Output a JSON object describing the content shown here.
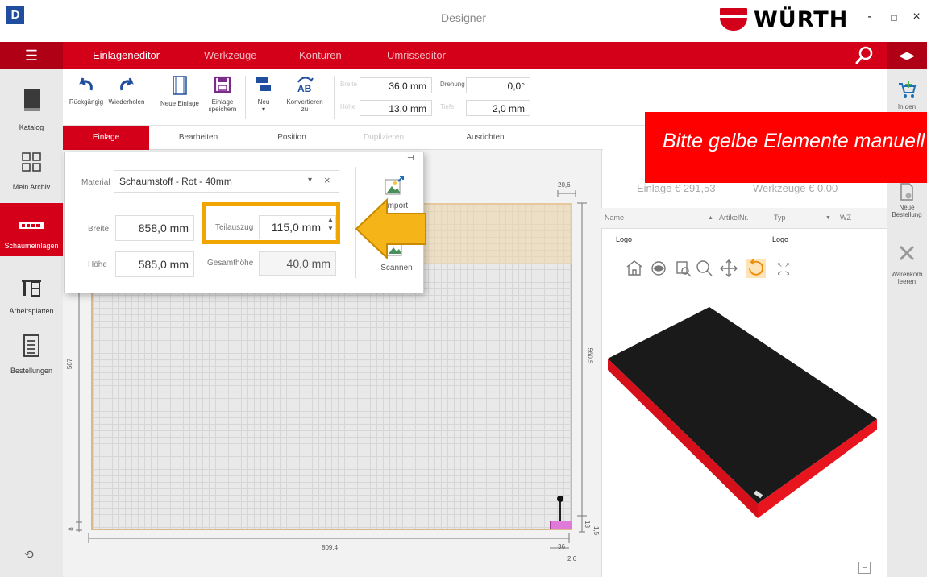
{
  "window": {
    "logo_letter": "D",
    "title": "Designer",
    "brand": "WÜRTH",
    "minimize": "-",
    "maximize": "□",
    "close": "×"
  },
  "menu": {
    "tabs": [
      "Einlageneditor",
      "Werkzeuge",
      "Konturen",
      "Umrisseditor"
    ]
  },
  "sidebar": {
    "items": [
      {
        "label": "Katalog"
      },
      {
        "label": "Mein Archiv"
      },
      {
        "label": "Schaumeinlagen"
      },
      {
        "label": "Arbeitsplatten"
      },
      {
        "label": "Bestellungen"
      }
    ]
  },
  "rightbar": {
    "cart_label": "In den",
    "new_order_label_1": "Neue",
    "new_order_label_2": "Bestellung",
    "clear_cart_label_1": "Warenkorb",
    "clear_cart_label_2": "leeren"
  },
  "ribbon": {
    "undo": "Rückgängig",
    "redo": "Wiederholen",
    "new_insert": "Neue Einlage",
    "save_1": "Einlage",
    "save_2": "speichern",
    "new_1": "Neu",
    "convert_1": "Konvertieren",
    "convert_2": "zu",
    "breite_label": "Breite",
    "breite_value": "36,0 mm",
    "hoehe_label": "Höhe",
    "hoehe_value": "13,0 mm",
    "drehung_label": "Drehung",
    "drehung_value": "0,0°",
    "tiefe_label": "Tiefe",
    "tiefe_value": "2,0 mm"
  },
  "subtabs": [
    "Einlage",
    "Bearbeiten",
    "Position",
    "Duplizieren",
    "Ausrichten"
  ],
  "panel": {
    "material_label": "Material",
    "material_value": "Schaumstoff - Rot - 40mm",
    "breite_label": "Breite",
    "breite_value": "858,0 mm",
    "hoehe_label": "Höhe",
    "hoehe_value": "585,0 mm",
    "teilauszug_label": "Teilauszug",
    "teilauszug_value": "115,0 mm",
    "gesamthoehe_label": "Gesamthöhe",
    "gesamthoehe_value": "40,0 mm",
    "import_label": "Import",
    "scan_label": "Scannen"
  },
  "dimensions": {
    "top_right": "20,6",
    "bottom": "809,4",
    "left": "567",
    "right": "560,5",
    "bottom_left": "8",
    "bottom_right_a": "36",
    "bottom_right_b": "2,6",
    "right_small_a": "13",
    "right_small_b": "1,5"
  },
  "right_pane": {
    "banner": "Bitte gelbe Elemente manuell",
    "price_einlage": "Einlage € 291,53",
    "price_werkzeuge": "Werkzeuge € 0,00",
    "columns": [
      "Name",
      "ArtikelNr.",
      "Typ",
      "WZ"
    ],
    "rows": [
      {
        "name": "Logo",
        "typ": "Logo"
      }
    ]
  },
  "colors": {
    "brand_red": "#d40019",
    "banner_red": "#ff0000",
    "highlight_orange": "#f0a500",
    "foam_black": "#1a1a1a",
    "foam_red": "#e8141e"
  }
}
